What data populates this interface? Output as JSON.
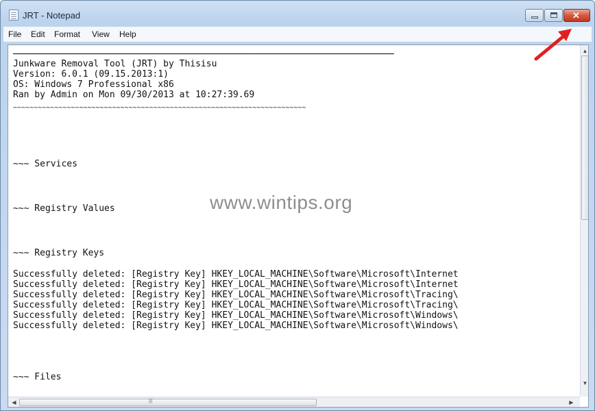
{
  "window": {
    "title": "JRT - Notepad",
    "close_symbol": "✕"
  },
  "menu": [
    "File",
    "Edit",
    "Format",
    "View",
    "Help"
  ],
  "document": {
    "separator_top": "───────────────────────────────────────────────────────────────────────",
    "lines": [
      "Junkware Removal Tool (JRT) by Thisisu",
      "Version: 6.0.1 (09.15.2013:1)",
      "OS: Windows 7 Professional x86",
      "Ran by Admin on Mon 09/30/2013 at 10:27:39.69"
    ],
    "separator_bottom": "~~~~~~~~~~~~~~~~~~~~~~~~~~~~~~~~~~~~~~~~~~~~~~~~~~~~~~~~~~~~~~~~~~~~~~~",
    "section_services": "~~~ Services",
    "section_registry_values": "~~~ Registry Values",
    "section_registry_keys": "~~~ Registry Keys",
    "deleted_lines": [
      "Successfully deleted: [Registry Key] HKEY_LOCAL_MACHINE\\Software\\Microsoft\\Internet",
      "Successfully deleted: [Registry Key] HKEY_LOCAL_MACHINE\\Software\\Microsoft\\Internet",
      "Successfully deleted: [Registry Key] HKEY_LOCAL_MACHINE\\Software\\Microsoft\\Tracing\\",
      "Successfully deleted: [Registry Key] HKEY_LOCAL_MACHINE\\Software\\Microsoft\\Tracing\\",
      "Successfully deleted: [Registry Key] HKEY_LOCAL_MACHINE\\Software\\Microsoft\\Windows\\",
      "Successfully deleted: [Registry Key] HKEY_LOCAL_MACHINE\\Software\\Microsoft\\Windows\\"
    ],
    "section_files": "~~~ Files"
  },
  "watermark": "www.wintips.org",
  "colors": {
    "annotation_arrow": "#e02020",
    "close_button": "#d45a3f"
  }
}
